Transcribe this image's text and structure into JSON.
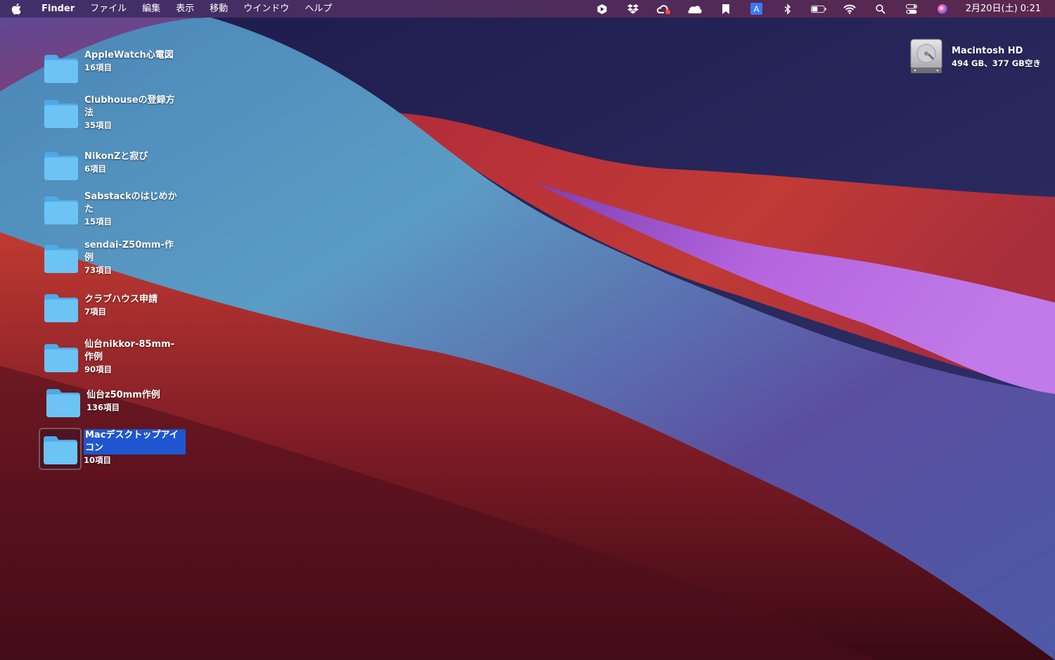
{
  "menubar": {
    "app_name": "Finder",
    "menus": [
      "ファイル",
      "編集",
      "表示",
      "移動",
      "ウインドウ",
      "ヘルプ"
    ],
    "tray_icons": [
      "paste-app-icon",
      "dropbox-icon",
      "creative-cloud-icon",
      "cloud-icon",
      "bookmark-icon",
      "input-source-icon",
      "bluetooth-icon",
      "battery-icon",
      "wifi-icon",
      "search-icon",
      "control-center-icon",
      "siri-icon"
    ],
    "input_source_label": "A",
    "clock": "2月20日(土) 0:21"
  },
  "folders": [
    {
      "name": "AppleWatch心電図",
      "count": "16項目"
    },
    {
      "name": "Clubhouseの登録方\n法",
      "count": "35項目"
    },
    {
      "name": "NikonZと寂び",
      "count": "6項目"
    },
    {
      "name": "Sabstackのはじめか\nた",
      "count": "15項目"
    },
    {
      "name": "sendai-Z50mm-作\n例",
      "count": "73項目"
    },
    {
      "name": "クラブハウス申請",
      "count": "7項目"
    },
    {
      "name": "仙台nikkor-85mm-\n作例",
      "count": "90項目"
    },
    {
      "name": "仙台z50mm作例",
      "count": "136項目"
    },
    {
      "name": "Macデスクトップアイ\nコン",
      "count": "10項目",
      "selected": true
    }
  ],
  "drive": {
    "name": "Macintosh HD",
    "info": "494 GB、377 GB空き"
  },
  "colors": {
    "folder_blue": "#6cc4f5",
    "selection_blue": "#1f56d0"
  }
}
